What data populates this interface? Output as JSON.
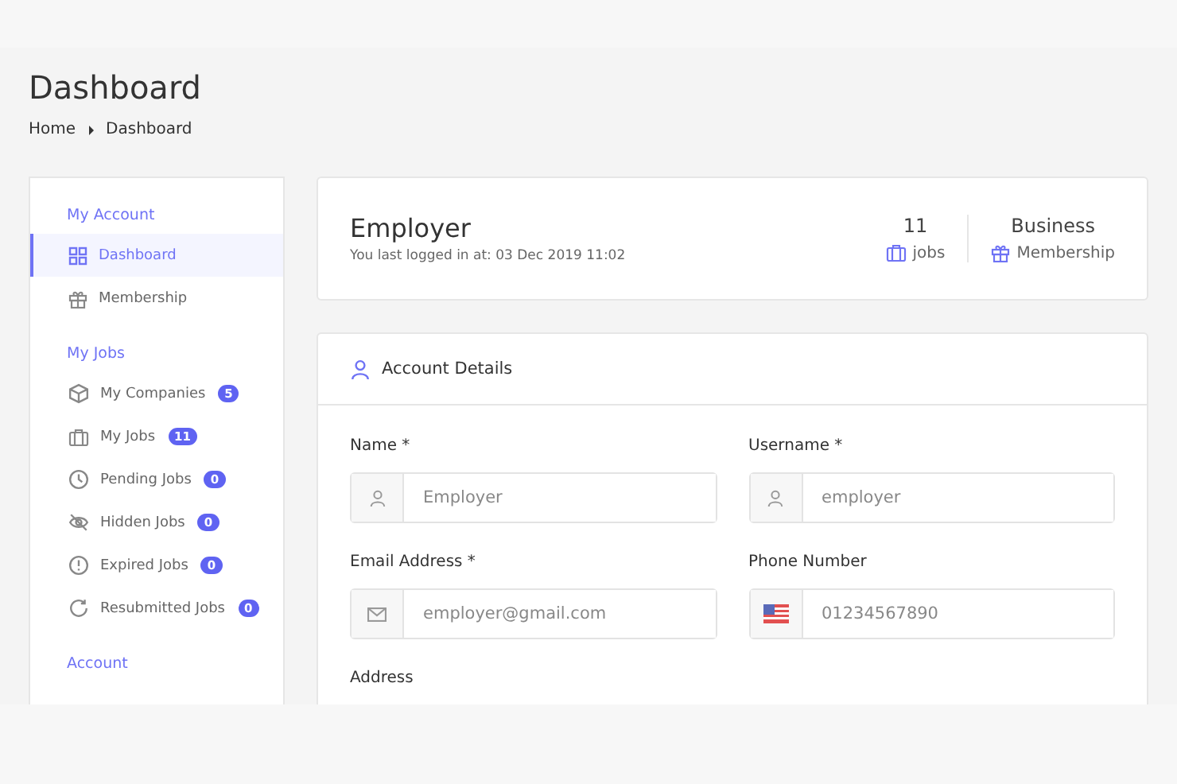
{
  "page": {
    "title": "Dashboard",
    "breadcrumb": [
      "Home",
      "Dashboard"
    ]
  },
  "sidebar": {
    "items": [
      {
        "kind": "heading",
        "label": "My Account"
      },
      {
        "kind": "link",
        "label": "Dashboard",
        "selected": true
      },
      {
        "kind": "link",
        "label": "Membership",
        "selected": false
      },
      {
        "kind": "heading",
        "label": "My Jobs"
      },
      {
        "kind": "link",
        "label": "My Companies",
        "badge": "5",
        "selected": false
      },
      {
        "kind": "link",
        "label": "My Jobs",
        "badge": "11",
        "selected": false
      },
      {
        "kind": "link",
        "label": "Pending Jobs",
        "badge": "0",
        "selected": false
      },
      {
        "kind": "link",
        "label": "Hidden Jobs",
        "badge": "0",
        "selected": false
      },
      {
        "kind": "link",
        "label": "Expired Jobs",
        "badge": "0",
        "selected": false
      },
      {
        "kind": "link",
        "label": "Resubmitted Jobs",
        "badge": "0",
        "selected": false
      },
      {
        "kind": "heading",
        "label": "Account"
      }
    ]
  },
  "profile": {
    "name": "Employer",
    "last_login": "You last logged in at: 03 Dec 2019 11:02",
    "stats": [
      {
        "value": "11",
        "label": "jobs"
      },
      {
        "value": "Business",
        "label": "Membership"
      }
    ]
  },
  "account_details": {
    "title": "Account Details",
    "fields": [
      {
        "label": "Name *",
        "value": "Employer"
      },
      {
        "label": "Username *",
        "value": "employer"
      },
      {
        "label": "Email Address *",
        "value": "employer@gmail.com"
      },
      {
        "label": "Phone Number",
        "value": "01234567890"
      },
      {
        "label": "Address"
      }
    ]
  }
}
